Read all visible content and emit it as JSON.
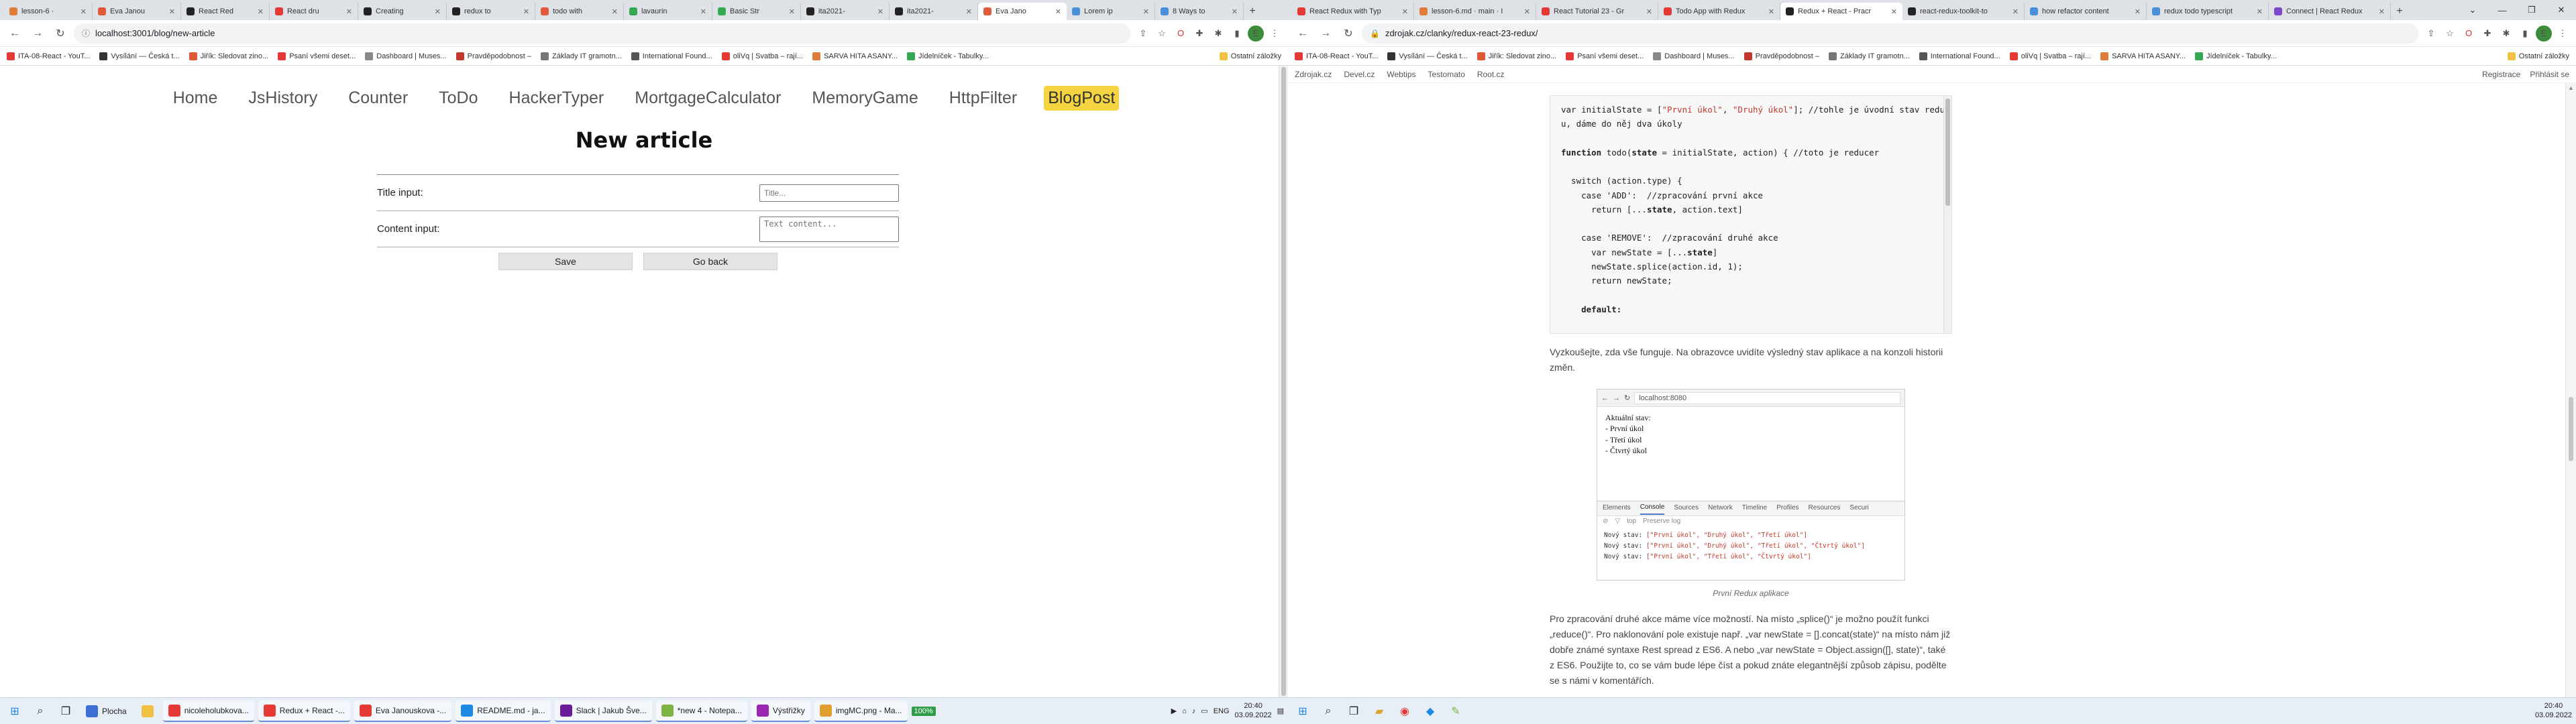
{
  "left": {
    "tabs": [
      {
        "label": "lesson-6 ·",
        "color": "#e07b39"
      },
      {
        "label": "Eva Janou",
        "color": "#e05a3a"
      },
      {
        "label": "React Red",
        "color": "#222"
      },
      {
        "label": "React dru",
        "color": "#e53935"
      },
      {
        "label": "Creating",
        "color": "#222"
      },
      {
        "label": "redux to",
        "color": "#222"
      },
      {
        "label": "todo with",
        "color": "#e05a3a"
      },
      {
        "label": "lavaurin",
        "color": "#34a853"
      },
      {
        "label": "Basic Str",
        "color": "#34a853"
      },
      {
        "label": "ita2021-",
        "color": "#222"
      },
      {
        "label": "ita2021-",
        "color": "#222"
      },
      {
        "label": "Eva Jano",
        "color": "#e05a3a",
        "active": true
      },
      {
        "label": "Lorem ip",
        "color": "#4a90d9"
      },
      {
        "label": "8 Ways to",
        "color": "#4a90d9"
      }
    ],
    "url": "localhost:3001/blog/new-article",
    "avatar_letter": "E",
    "bookmarks": [
      {
        "label": "ITA-08-React - YouT...",
        "color": "#e53935"
      },
      {
        "label": "Vysílání — Česká t...",
        "color": "#333"
      },
      {
        "label": "Jiřík: Sledovat zino...",
        "color": "#e05a3a"
      },
      {
        "label": "Psaní všemi deset...",
        "color": "#e53935"
      },
      {
        "label": "Dashboard | Muses...",
        "color": "#888"
      },
      {
        "label": "Pravděpodobnost –",
        "color": "#c0392b"
      },
      {
        "label": "Základy IT gramotn...",
        "color": "#777"
      },
      {
        "label": "International Found...",
        "color": "#555"
      },
      {
        "label": "oliVq | Svatba – rají...",
        "color": "#e53935"
      },
      {
        "label": "SARVA HITA ASANY...",
        "color": "#e07b39"
      },
      {
        "label": "Jídelníček - Tabulky...",
        "color": "#34a853"
      }
    ],
    "other_bookmarks": "Ostatní záložky",
    "nav": [
      "Home",
      "JsHistory",
      "Counter",
      "ToDo",
      "HackerTyper",
      "MortgageCalculator",
      "MemoryGame",
      "HttpFilter",
      "BlogPost"
    ],
    "active_nav_index": 8,
    "page_title": "New article",
    "title_label": "Title input:",
    "title_placeholder": "Title...",
    "content_label": "Content input:",
    "content_placeholder": "Text content...",
    "save_label": "Save",
    "back_label": "Go back"
  },
  "right": {
    "tabs": [
      {
        "label": "React Redux with Typ",
        "color": "#e53935"
      },
      {
        "label": "lesson-6.md · main · I",
        "color": "#e07b39"
      },
      {
        "label": "React Tutorial 23 - Gr",
        "color": "#e53935"
      },
      {
        "label": "Todo App with Redux",
        "color": "#e53935"
      },
      {
        "label": "Redux + React - Pracr",
        "color": "#222",
        "active": true
      },
      {
        "label": "react-redux-toolkit-to",
        "color": "#222"
      },
      {
        "label": "how refactor content",
        "color": "#4a90d9"
      },
      {
        "label": "redux todo typescript",
        "color": "#4a90d9"
      },
      {
        "label": "Connect | React Redux",
        "color": "#7b4ac9"
      }
    ],
    "url": "zdrojak.cz/clanky/redux-react-23-redux/",
    "avatar_letter": "E",
    "bookmarks": [
      {
        "label": "ITA-08-React - YouT...",
        "color": "#e53935"
      },
      {
        "label": "Vysílání — Česká t...",
        "color": "#333"
      },
      {
        "label": "Jiřík: Sledovat zino...",
        "color": "#e05a3a"
      },
      {
        "label": "Psaní všemi deset...",
        "color": "#e53935"
      },
      {
        "label": "Dashboard | Muses...",
        "color": "#888"
      },
      {
        "label": "Pravděpodobnost –",
        "color": "#c0392b"
      },
      {
        "label": "Základy IT gramotn...",
        "color": "#777"
      },
      {
        "label": "International Found...",
        "color": "#555"
      },
      {
        "label": "oliVq | Svatba – rají...",
        "color": "#e53935"
      },
      {
        "label": "SARVA HITA ASANY...",
        "color": "#e07b39"
      },
      {
        "label": "Jídelníček - Tabulky...",
        "color": "#34a853"
      }
    ],
    "other_bookmarks": "Ostatní záložky",
    "site_links": [
      "Zdrojak.cz",
      "Devel.cz",
      "Webtips",
      "Testomato",
      "Root.cz"
    ],
    "site_right": [
      "Registrace",
      "Přihlásit se"
    ],
    "code": {
      "l1a": "var initialState = [",
      "l1b": "\"První úkol\"",
      "l1c": ", ",
      "l1d": "\"Druhý úkol\"",
      "l1e": "]; //tohle je úvodní stav reducer",
      "l2": "u, dáme do něj dva úkoly",
      "l3a": "function",
      "l3b": " todo(",
      "l3c": "state",
      "l3d": " = initialState, action) { //toto je reducer",
      "l4": "  switch (action.type) {",
      "l5": "    case 'ADD':  //zpracování první akce",
      "l6a": "      return [...",
      "l6b": "state",
      "l6c": ", action.text]",
      "l7": "    case 'REMOVE':  //zpracování druhé akce",
      "l8a": "      var newState = [...",
      "l8b": "state",
      "l8c": "]",
      "l9": "      newState.splice(action.id, 1);",
      "l10": "      return newState;",
      "l11": "    default:"
    },
    "p1": "Vyzkoušejte, zda vše funguje. Na obrazovce uvidíte výsledný stav aplikace a na konzoli historii změn.",
    "fig_url": "localhost:8080",
    "fig_output": [
      "Aktuální stav:",
      "- První úkol",
      "- Třetí úkol",
      "- Čtvrtý úkol"
    ],
    "fig_tabs": [
      "Elements",
      "Console",
      "Sources",
      "Network",
      "Timeline",
      "Profiles",
      "Resources",
      "Securi"
    ],
    "fig_active_tab": "Console",
    "fig_filter": "top",
    "fig_preserve": "Preserve log",
    "fig_log": [
      {
        "k": "Nový stav: ",
        "v": "[\"První úkol\", \"Druhý úkol\", \"Třetí úkol\"]"
      },
      {
        "k": "Nový stav: ",
        "v": "[\"První úkol\", \"Druhý úkol\", \"Třetí úkol\", \"Čtvrtý úkol\"]"
      },
      {
        "k": "Nový stav: ",
        "v": "[\"První úkol\", \"Třetí úkol\", \"Čtvrtý úkol\"]"
      }
    ],
    "caption": "První Redux aplikace",
    "p2": "Pro zpracování druhé akce máme více možností. Na místo „splice()“ je možno použít funkci „reduce()“. Pro naklonování pole existuje např. „var newState = [].concat(state)“ na místo nám již dobře známé syntaxe Rest spread z ES6. A nebo „var newState = Object.assign([], state)“, také z ES6. Použijte to, co se vám bude lépe číst a pokud znáte elegantnější způsob zápisu, podělte se s námi v komentářích."
  },
  "taskbar": {
    "left_items": [
      {
        "label": "Plocha",
        "color": "#3b6fd4"
      },
      {
        "label": "",
        "color": "#f0c040"
      },
      {
        "label": "nicoleholubkova...",
        "color": "#e53935"
      },
      {
        "label": "Redux + React -...",
        "color": "#e53935"
      },
      {
        "label": "Eva Janouskova -...",
        "color": "#e53935"
      },
      {
        "label": "README.md - ja...",
        "color": "#1e88e5"
      },
      {
        "label": "Slack | Jakub Šve...",
        "color": "#6a1b9a"
      },
      {
        "label": "*new 4 - Notepa...",
        "color": "#7cb342"
      },
      {
        "label": "Výstřižky",
        "color": "#9c27b0"
      },
      {
        "label": "imgMC.png - Ma...",
        "color": "#e0a030"
      }
    ],
    "zoom": "100%",
    "lang": "ENG",
    "time": "20:40",
    "date": "03.09.2022",
    "right_time": "20:40",
    "right_date": "03.09.2022"
  }
}
